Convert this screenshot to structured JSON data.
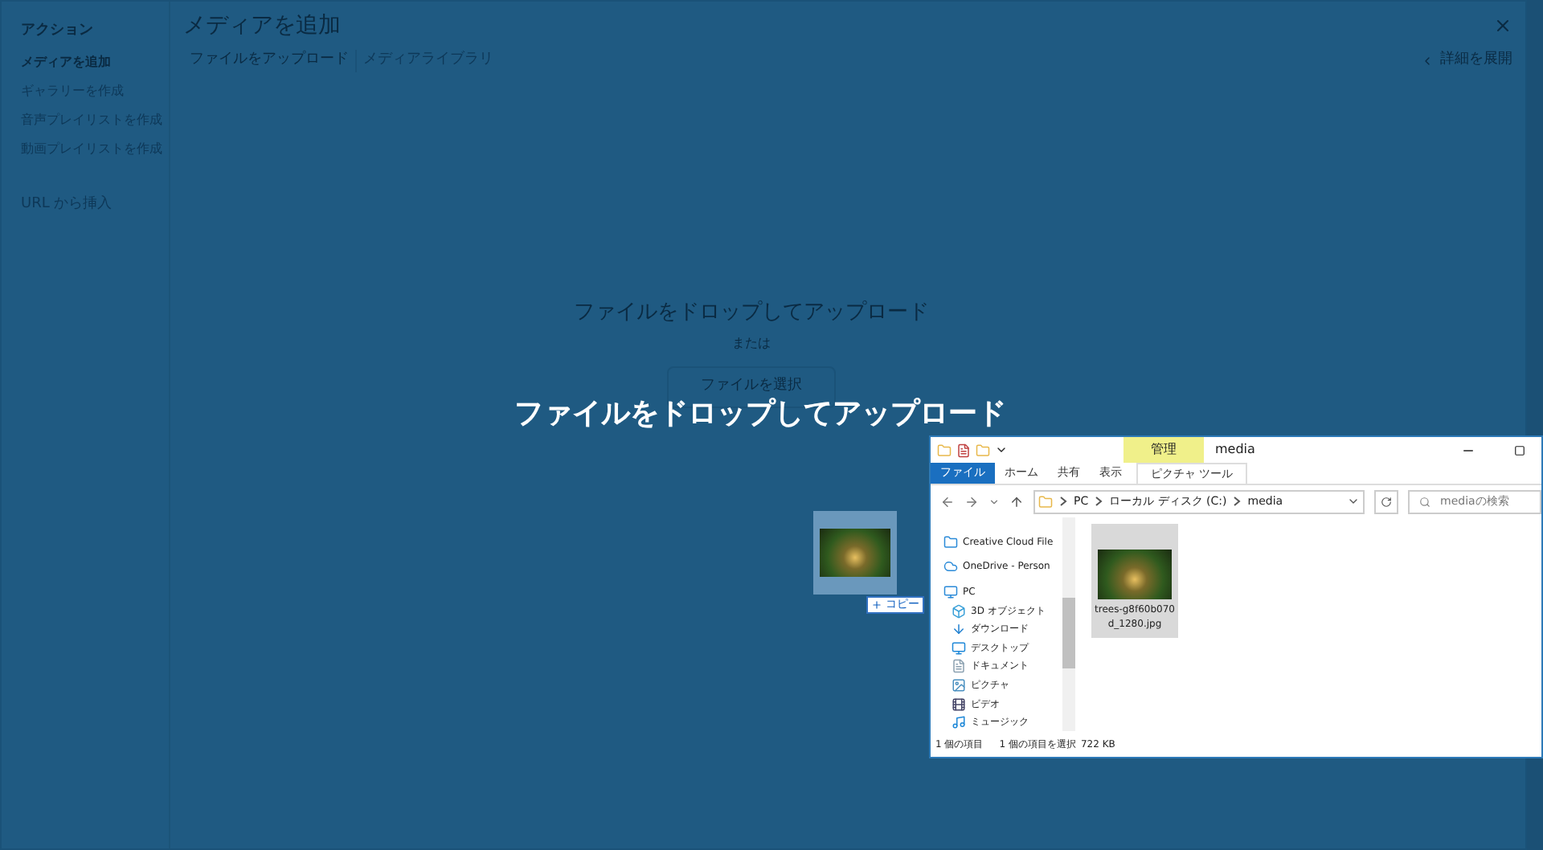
{
  "modal": {
    "sidebar": {
      "heading": "アクション",
      "items": [
        {
          "label": "メディアを追加",
          "selected": true
        },
        {
          "label": "ギャラリーを作成",
          "selected": false
        },
        {
          "label": "音声プレイリストを作成",
          "selected": false
        },
        {
          "label": "動画プレイリストを作成",
          "selected": false
        }
      ],
      "url_link": "URL から挿入"
    },
    "title": "メディアを追加",
    "tabs": [
      {
        "label": "ファイルをアップロード",
        "selected": true
      },
      {
        "label": "メディアライブラリ",
        "selected": false
      }
    ],
    "details_toggle": "詳細を展開",
    "upload": {
      "instructions": "ファイルをドロップしてアップロード",
      "or": "または",
      "button": "ファイルを選択"
    }
  },
  "drop_overlay": {
    "message": "ファイルをドロップしてアップロード"
  },
  "drag_ghost": {
    "badge": "コピー"
  },
  "explorer": {
    "title": "media",
    "context_tab": "管理",
    "tabs": [
      {
        "label": "ファイル",
        "selected": true
      },
      {
        "label": "ホーム",
        "selected": false
      },
      {
        "label": "共有",
        "selected": false
      },
      {
        "label": "表示",
        "selected": false
      },
      {
        "label": "ピクチャ ツール",
        "selected": false
      }
    ],
    "address": [
      "PC",
      "ローカル ディスク (C:)",
      "media"
    ],
    "search": {
      "placeholder": "mediaの検索"
    },
    "nav": [
      {
        "label": "Creative Cloud File"
      },
      {
        "label": "OneDrive - Person"
      },
      {
        "label": "PC",
        "children": [
          {
            "label": "3D オブジェクト"
          },
          {
            "label": "ダウンロード"
          },
          {
            "label": "デスクトップ"
          },
          {
            "label": "ドキュメント"
          },
          {
            "label": "ピクチャ"
          },
          {
            "label": "ビデオ"
          },
          {
            "label": "ミュージック"
          }
        ]
      }
    ],
    "files": [
      {
        "name": "trees-g8f60b070d_1280.jpg",
        "selected": true
      }
    ],
    "status": [
      "1 個の項目",
      "1 個の項目を選択",
      "722 KB"
    ]
  }
}
